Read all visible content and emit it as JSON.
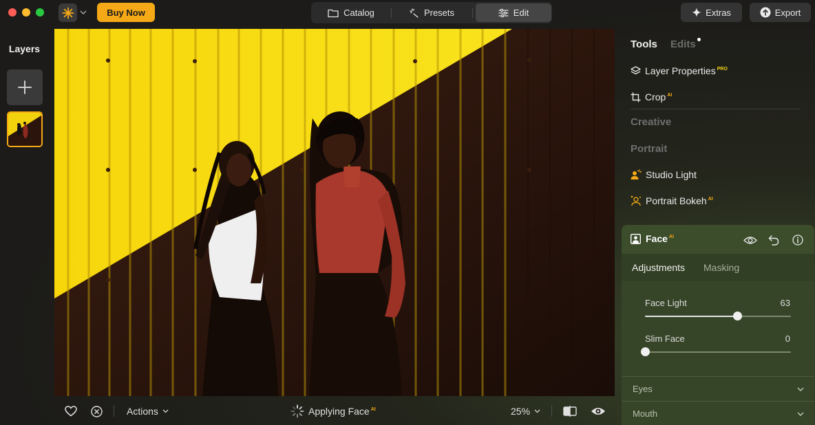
{
  "app": {
    "buy_now": "Buy Now",
    "accent_color": "#f6a916"
  },
  "nav": {
    "tabs": [
      {
        "label": "Catalog",
        "icon": "folder-icon"
      },
      {
        "label": "Presets",
        "icon": "magic-wand-icon"
      },
      {
        "label": "Edit",
        "icon": "sliders-icon",
        "active": true
      }
    ],
    "extras": "Extras",
    "export": "Export"
  },
  "layers": {
    "title": "Layers"
  },
  "bottom": {
    "actions": "Actions",
    "status": "Applying Face",
    "status_badge": "AI",
    "zoom": "25%"
  },
  "panel": {
    "tabs": {
      "tools": "Tools",
      "edits": "Edits"
    },
    "tools": [
      {
        "label": "Layer Properties",
        "badge": "PRO",
        "icon": "layers-icon"
      },
      {
        "label": "Crop",
        "badge": "AI",
        "icon": "crop-icon"
      }
    ],
    "sections": {
      "creative": "Creative",
      "portrait": "Portrait"
    },
    "portrait_tools": [
      {
        "label": "Studio Light",
        "badge": "",
        "icon": "studio-light-icon"
      },
      {
        "label": "Portrait Bokeh",
        "badge": "AI",
        "icon": "portrait-bokeh-icon"
      }
    ],
    "face": {
      "title": "Face",
      "badge": "AI",
      "tabs": {
        "adjustments": "Adjustments",
        "masking": "Masking"
      },
      "sliders": [
        {
          "label": "Face Light",
          "value": "63",
          "fraction": 0.63
        },
        {
          "label": "Slim Face",
          "value": "0",
          "fraction": 0.0
        }
      ],
      "accordions": [
        "Eyes",
        "Mouth"
      ]
    }
  }
}
